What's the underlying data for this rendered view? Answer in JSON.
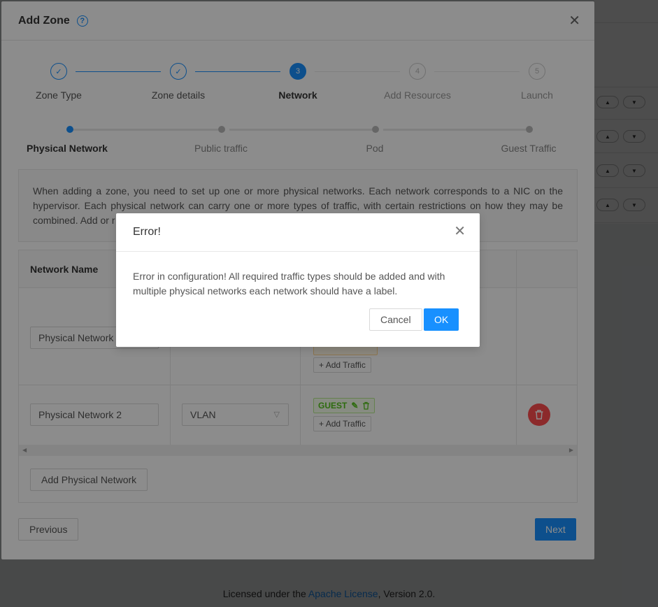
{
  "background": {
    "footer_prefix": "Licensed under the",
    "footer_link": "Apache License",
    "footer_suffix": ", Version 2.0."
  },
  "zone_modal": {
    "title": "Add Zone",
    "steps": [
      {
        "label": "Zone Type",
        "status": "done",
        "number": ""
      },
      {
        "label": "Zone details",
        "status": "done",
        "number": ""
      },
      {
        "label": "Network",
        "status": "active",
        "number": "3"
      },
      {
        "label": "Add Resources",
        "status": "wait",
        "number": "4"
      },
      {
        "label": "Launch",
        "status": "wait",
        "number": "5"
      }
    ],
    "substeps": [
      {
        "label": "Physical Network",
        "status": "active"
      },
      {
        "label": "Public traffic",
        "status": "wait"
      },
      {
        "label": "Pod",
        "status": "wait"
      },
      {
        "label": "Guest Traffic",
        "status": "wait"
      }
    ],
    "info_text": "When adding a zone, you need to set up one or more physical networks. Each network corresponds to a NIC on the hypervisor. Each physical network can carry one or more types of traffic, with certain restrictions on how they may be combined. Add or r",
    "table": {
      "column_header": "Network Name",
      "rows": [
        {
          "name": "Physical Network"
        },
        {
          "name": "Physical Network 2",
          "isolation": "VLAN",
          "traffic_tag": "GUEST"
        }
      ],
      "add_traffic_label": "Add Traffic"
    },
    "add_network_label": "Add Physical Network",
    "previous_label": "Previous",
    "next_label": "Next"
  },
  "error_dialog": {
    "title": "Error!",
    "message": "Error in configuration! All required traffic types should be added and with multiple physical networks each network should have a label.",
    "cancel_label": "Cancel",
    "ok_label": "OK"
  },
  "colors": {
    "primary": "#1890ff",
    "danger": "#ff4d4f",
    "guest_tag": "#52c41a"
  }
}
